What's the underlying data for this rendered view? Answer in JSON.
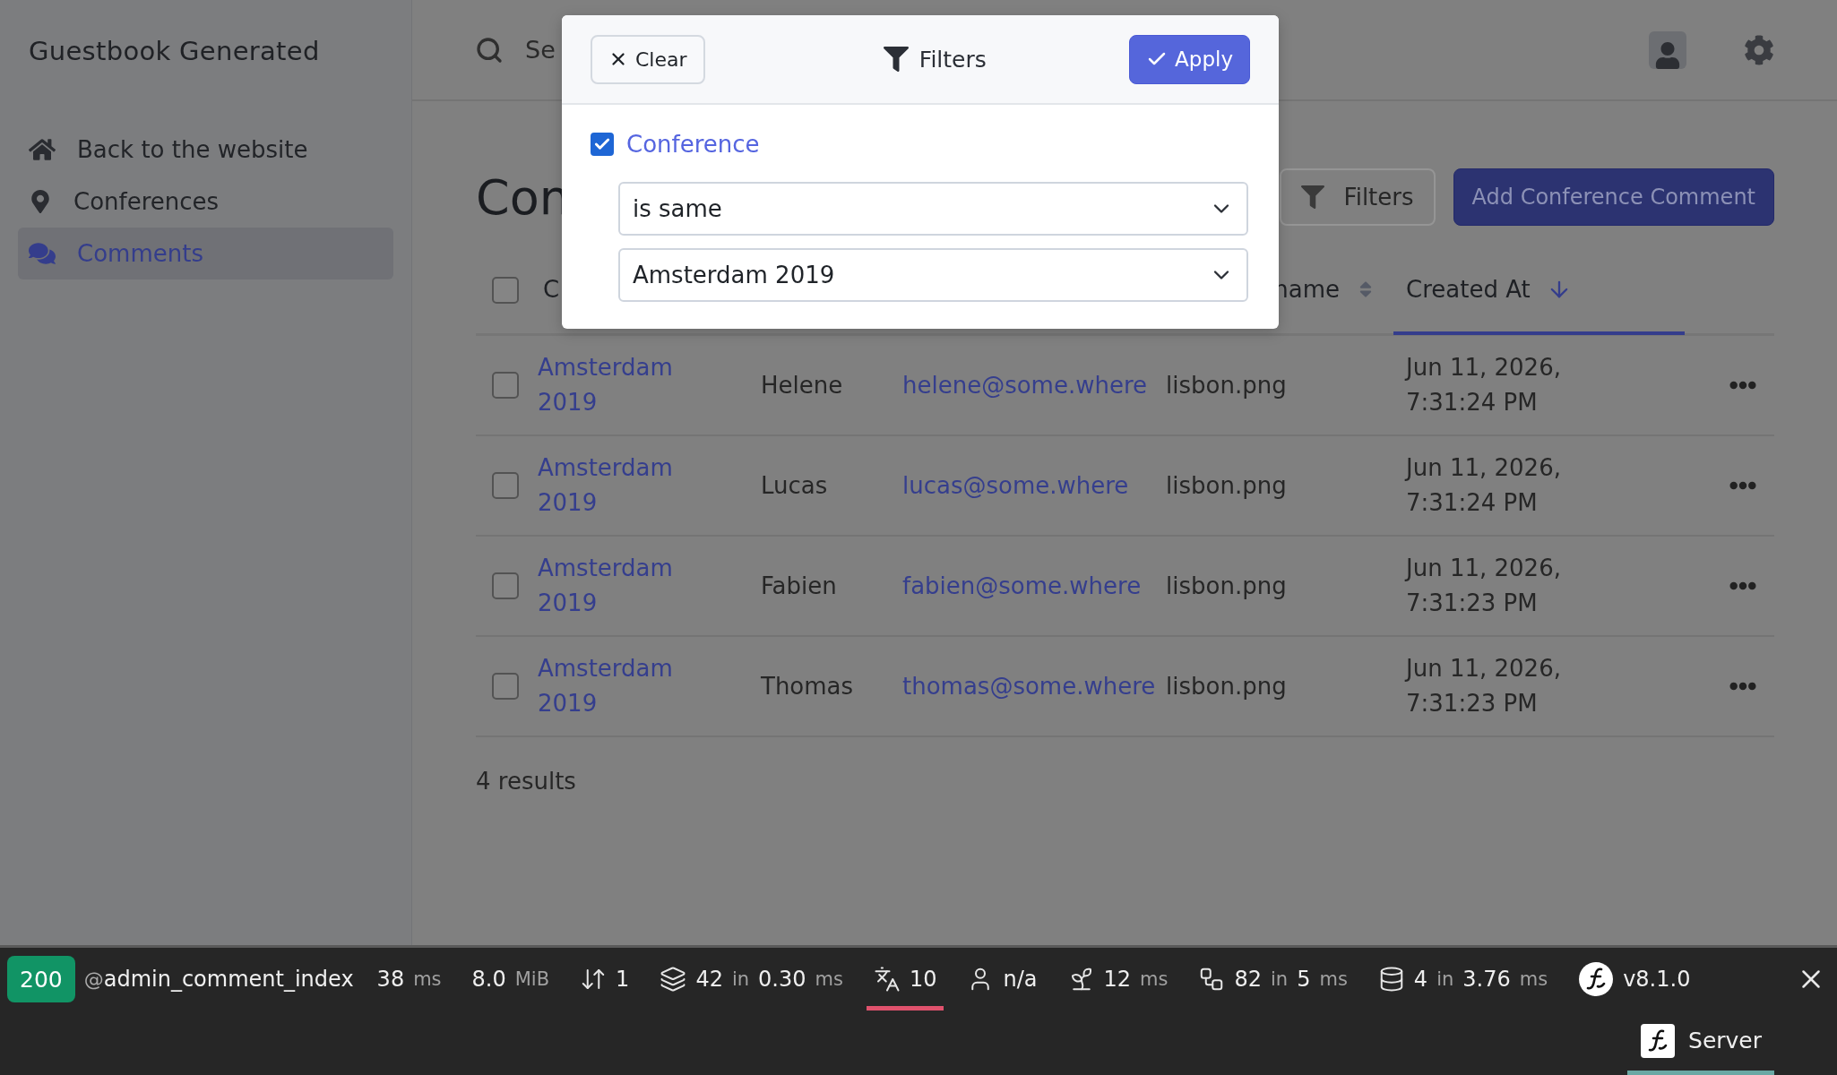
{
  "sidebar": {
    "title": "Guestbook Generated",
    "items": [
      {
        "label": "Back to the website",
        "selected": false
      },
      {
        "label": "Conferences",
        "selected": false
      },
      {
        "label": "Comments",
        "selected": true
      }
    ]
  },
  "header": {
    "search_placeholder": "Se"
  },
  "page": {
    "title": "Con",
    "filters_button": "Filters",
    "add_button": "Add Conference Comment"
  },
  "table": {
    "select_all_checked": false,
    "columns": [
      {
        "label": "C",
        "selected": false
      },
      {
        "label": "name",
        "selected": false
      },
      {
        "label": "Created At",
        "selected": true
      }
    ],
    "rows": [
      {
        "conference": "Amsterdam 2019",
        "author": "Helene",
        "email": "helene@some.where",
        "photo": "lisbon.png",
        "created_at": "Jun 11, 2026, 7:31:24 PM",
        "checked": false
      },
      {
        "conference": "Amsterdam 2019",
        "author": "Lucas",
        "email": "lucas@some.where",
        "photo": "lisbon.png",
        "created_at": "Jun 11, 2026, 7:31:24 PM",
        "checked": false
      },
      {
        "conference": "Amsterdam 2019",
        "author": "Fabien",
        "email": "fabien@some.where",
        "photo": "lisbon.png",
        "created_at": "Jun 11, 2026, 7:31:23 PM",
        "checked": false
      },
      {
        "conference": "Amsterdam 2019",
        "author": "Thomas",
        "email": "thomas@some.where",
        "photo": "lisbon.png",
        "created_at": "Jun 11, 2026, 7:31:23 PM",
        "checked": false
      }
    ],
    "footer": "4 results"
  },
  "filter_modal": {
    "clear_button": "Clear",
    "title": "Filters",
    "apply_button": "Apply",
    "filters": [
      {
        "label": "Conference",
        "checked": true,
        "operator": "is same",
        "value": "Amsterdam 2019"
      }
    ]
  },
  "toolbar": {
    "status": "200",
    "route_prefix": "@",
    "route": "admin_comment_index",
    "items": [
      {
        "selected": false,
        "segments": [
          {
            "text": "38",
            "muted": false
          },
          {
            "text": "ms",
            "muted": true
          }
        ]
      },
      {
        "selected": false,
        "segments": [
          {
            "text": "8.0",
            "muted": false
          },
          {
            "text": "MiB",
            "muted": true
          }
        ]
      },
      {
        "selected": false,
        "segments": [
          {
            "text": "1",
            "muted": false
          }
        ]
      },
      {
        "selected": false,
        "segments": [
          {
            "text": "42",
            "muted": false
          },
          {
            "text": "in",
            "muted": true
          },
          {
            "text": "0.30",
            "muted": false
          },
          {
            "text": "ms",
            "muted": true
          }
        ]
      },
      {
        "selected": true,
        "segments": [
          {
            "text": "10",
            "muted": false
          }
        ]
      },
      {
        "selected": false,
        "segments": [
          {
            "text": "n/a",
            "muted": false
          }
        ]
      },
      {
        "selected": false,
        "segments": [
          {
            "text": "12",
            "muted": false
          },
          {
            "text": "ms",
            "muted": true
          }
        ]
      },
      {
        "selected": false,
        "segments": [
          {
            "text": "82",
            "muted": false
          },
          {
            "text": "in",
            "muted": true
          },
          {
            "text": "5",
            "muted": false
          },
          {
            "text": "ms",
            "muted": true
          }
        ]
      },
      {
        "selected": false,
        "segments": [
          {
            "text": "4",
            "muted": false
          },
          {
            "text": "in",
            "muted": true
          },
          {
            "text": "3.76",
            "muted": false
          },
          {
            "text": "ms",
            "muted": true
          }
        ]
      },
      {
        "selected": false,
        "segments": [
          {
            "text": "v8.1.0",
            "muted": false
          }
        ]
      }
    ],
    "tabs": [
      {
        "label": "Server",
        "selected": true
      }
    ]
  }
}
